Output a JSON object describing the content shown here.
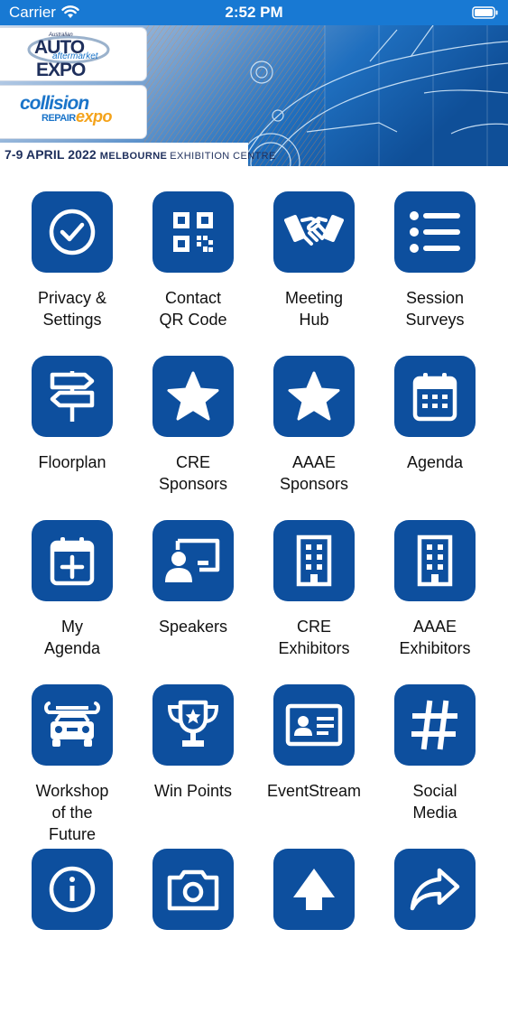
{
  "status_bar": {
    "carrier": "Carrier",
    "time": "2:52 PM"
  },
  "banner": {
    "logo_auto_small": "Australian",
    "logo_auto_main": "AUTO",
    "logo_auto_sub": "aftermarket",
    "logo_auto_expo": "EXPO",
    "logo_collision_main": "collision",
    "logo_collision_repair": "REPAIR",
    "logo_collision_expo": "expo",
    "dates": "7-9 APRIL 2022",
    "venue_city": "MELBOURNE",
    "venue_rest": "EXHIBITION CENTRE"
  },
  "colors": {
    "status_bar": "#1879d3",
    "tile": "#0d4f9e",
    "brand_navy": "#1e2f5c",
    "brand_blue": "#1a74c9",
    "brand_orange": "#f4a31b"
  },
  "tiles": [
    {
      "label": "Privacy &\nSettings",
      "icon": "check-circle-icon"
    },
    {
      "label": "Contact\nQR Code",
      "icon": "qr-code-icon"
    },
    {
      "label": "Meeting\nHub",
      "icon": "handshake-icon"
    },
    {
      "label": "Session\nSurveys",
      "icon": "list-icon"
    },
    {
      "label": "Floorplan",
      "icon": "signpost-icon"
    },
    {
      "label": "CRE\nSponsors",
      "icon": "star-icon"
    },
    {
      "label": "AAAE\nSponsors",
      "icon": "star-icon"
    },
    {
      "label": "Agenda",
      "icon": "calendar-icon"
    },
    {
      "label": "My\nAgenda",
      "icon": "calendar-plus-icon"
    },
    {
      "label": "Speakers",
      "icon": "presenter-icon"
    },
    {
      "label": "CRE\nExhibitors",
      "icon": "building-icon"
    },
    {
      "label": "AAAE\nExhibitors",
      "icon": "building-icon"
    },
    {
      "label": "Workshop\nof the\nFuture",
      "icon": "car-wrench-icon"
    },
    {
      "label": "Win Points",
      "icon": "trophy-icon"
    },
    {
      "label": "EventStream",
      "icon": "id-card-icon"
    },
    {
      "label": "Social\nMedia",
      "icon": "hashtag-icon"
    },
    {
      "label": "",
      "icon": "info-icon"
    },
    {
      "label": "",
      "icon": "camera-icon"
    },
    {
      "label": "",
      "icon": "arrow-up-icon"
    },
    {
      "label": "",
      "icon": "share-icon"
    }
  ]
}
